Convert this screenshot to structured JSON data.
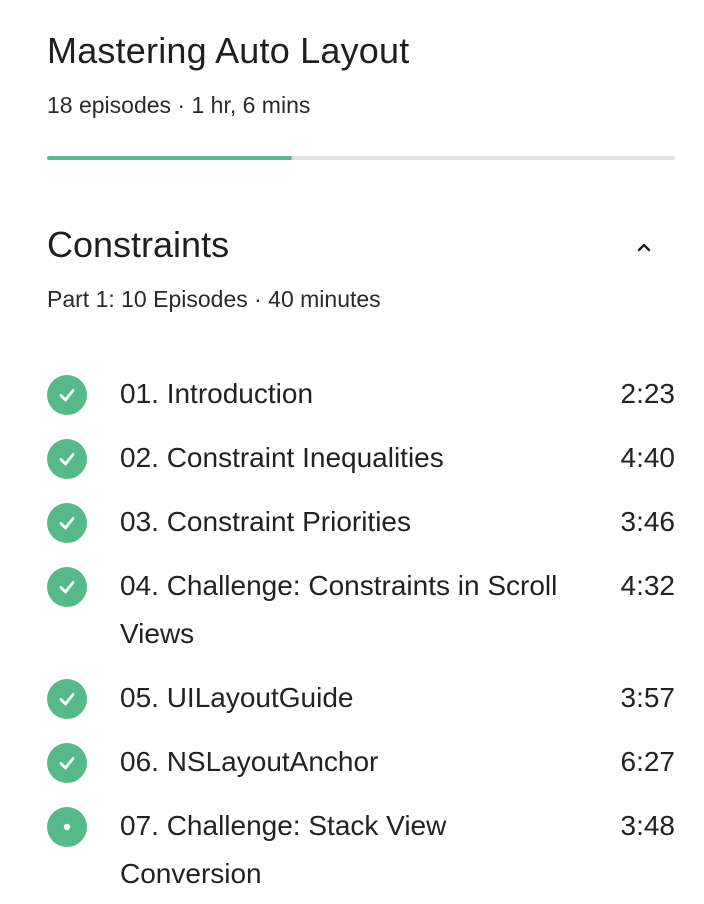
{
  "course": {
    "title": "Mastering Auto Layout",
    "meta": "18 episodes · 1 hr, 6 mins",
    "progress_fraction": 0.39
  },
  "colors": {
    "accent": "#56b98a",
    "track": "#e2e2e2",
    "text": "#1f1f1f"
  },
  "section": {
    "title": "Constraints",
    "meta": "Part 1: 10 Episodes · 40 minutes",
    "toggle_icon": "chevron-up-icon",
    "expanded": true
  },
  "episodes": [
    {
      "title": "01. Introduction",
      "duration": "2:23",
      "status": "completed"
    },
    {
      "title": "02. Constraint Inequalities",
      "duration": "4:40",
      "status": "completed"
    },
    {
      "title": "03. Constraint Priorities",
      "duration": "3:46",
      "status": "completed"
    },
    {
      "title": "04. Challenge: Constraints in Scroll Views",
      "duration": "4:32",
      "status": "completed"
    },
    {
      "title": "05. UILayoutGuide",
      "duration": "3:57",
      "status": "completed"
    },
    {
      "title": "06. NSLayoutAnchor",
      "duration": "6:27",
      "status": "completed"
    },
    {
      "title": "07. Challenge: Stack View Conversion",
      "duration": "3:48",
      "status": "in-progress"
    }
  ]
}
